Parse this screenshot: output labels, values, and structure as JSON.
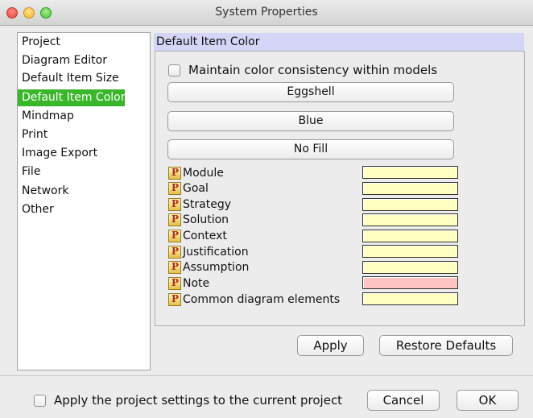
{
  "window": {
    "title": "System Properties"
  },
  "sidebar": {
    "items": [
      {
        "label": "Project",
        "selected": false
      },
      {
        "label": "Diagram Editor",
        "selected": false
      },
      {
        "label": "Default Item Size",
        "selected": false
      },
      {
        "label": "Default Item Color",
        "selected": true
      },
      {
        "label": "Mindmap",
        "selected": false
      },
      {
        "label": "Print",
        "selected": false
      },
      {
        "label": "Image Export",
        "selected": false
      },
      {
        "label": "File",
        "selected": false
      },
      {
        "label": "Network",
        "selected": false
      },
      {
        "label": "Other",
        "selected": false
      }
    ],
    "selected_color": "#3ab62a"
  },
  "panel": {
    "title": "Default Item Color",
    "maintain_consistency": {
      "label": "Maintain color consistency within models",
      "checked": false
    },
    "buttons": {
      "eggshell": "Eggshell",
      "blue": "Blue",
      "no_fill": "No Fill"
    },
    "items": [
      {
        "label": "Module",
        "color": "#ffffc0"
      },
      {
        "label": "Goal",
        "color": "#ffffc0"
      },
      {
        "label": "Strategy",
        "color": "#ffffc0"
      },
      {
        "label": "Solution",
        "color": "#ffffc0"
      },
      {
        "label": "Context",
        "color": "#ffffc0"
      },
      {
        "label": "Justification",
        "color": "#ffffc0"
      },
      {
        "label": "Assumption",
        "color": "#ffffc0"
      },
      {
        "label": "Note",
        "color": "#ffc4c4"
      },
      {
        "label": "Common diagram elements",
        "color": "#ffffc0"
      }
    ],
    "apply_label": "Apply",
    "restore_label": "Restore Defaults"
  },
  "footer": {
    "apply_project": {
      "label": "Apply the project settings to the current project",
      "checked": false
    },
    "cancel_label": "Cancel",
    "ok_label": "OK"
  }
}
